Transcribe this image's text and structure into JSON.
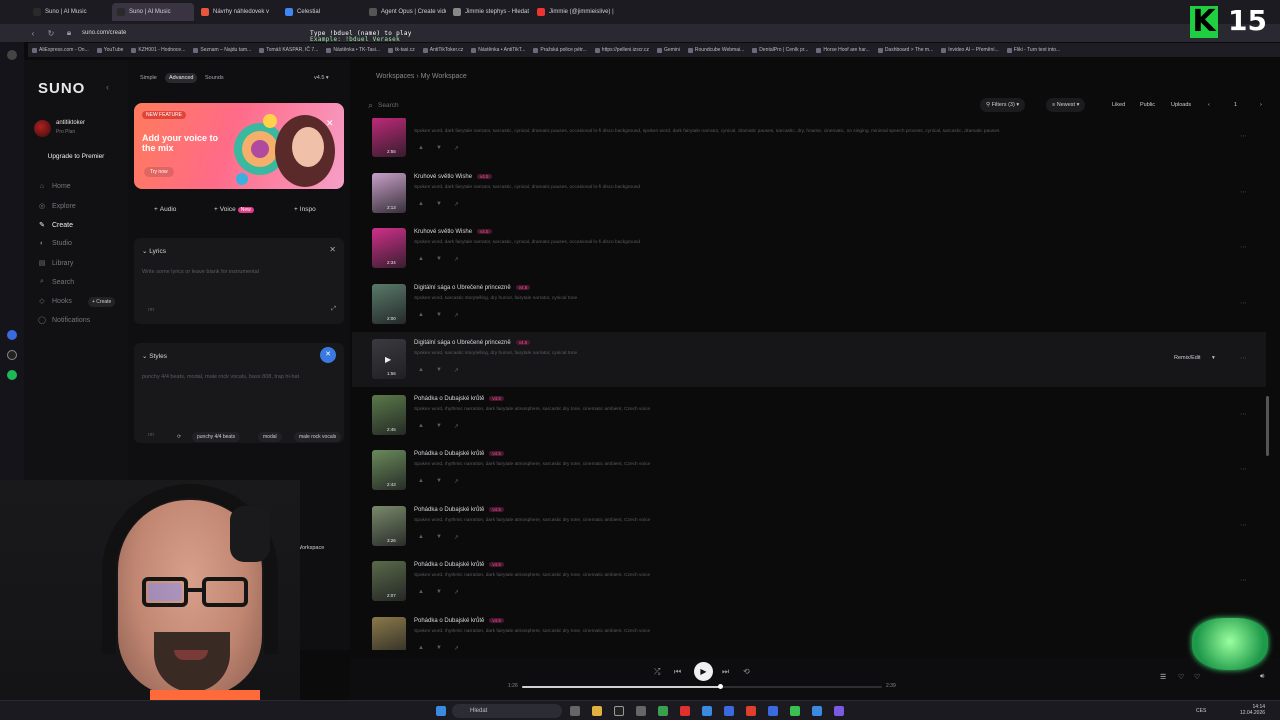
{
  "browser": {
    "tabs": [
      {
        "title": "Suno | AI Music",
        "color": "#2a2a2a"
      },
      {
        "title": "Suno | AI Music",
        "color": "#2a2a2a",
        "active": true
      },
      {
        "title": "Návrhy náhledovek v",
        "color": "#e8553d"
      },
      {
        "title": "Celestial",
        "color": "#4285f4"
      },
      {
        "title": "Agent Opus | Create video",
        "color": "#555"
      },
      {
        "title": "Jimmie stephys - Hledat G",
        "color": "#888"
      },
      {
        "title": "Jimmie (@jimmieislive) | T",
        "color": "#e33"
      }
    ],
    "url": "suno.com/create",
    "bookmarks": [
      "AliExpress.com - On...",
      "YouTube",
      "KZH001 - Hodnoce...",
      "Seznam – Najdu tam...",
      "Tomáš KASPAR, IČ 7...",
      "Nástěnka • TK-Tasi...",
      "tk-tasi.cz",
      "AntiTikToker.cz",
      "Nástěnka • AntiTikT...",
      "Pražská police pétr...",
      "https://pelleni.izscr.cz",
      "Gemini",
      "Roundcube Webmai...",
      "DentalPro | Ceník pr...",
      "Horse Hoof are har...",
      "Dashboard > The m...",
      "Invideo AI – Přemění...",
      "Fliki - Turn text into..."
    ]
  },
  "overlay": {
    "line1": "Type !bduel (name) to play",
    "line2": "Example: !bduel Verasek",
    "badge_letter": "K",
    "badge_number": "15"
  },
  "sidebar": {
    "logo": "SUNO",
    "username": "antitiktoker",
    "plan": "Pro Plan",
    "upgrade": "Upgrade to Premier",
    "nav": [
      {
        "label": "Home",
        "icon": "⌂"
      },
      {
        "label": "Explore",
        "icon": "◎"
      },
      {
        "label": "Create",
        "icon": "✎",
        "active": true
      },
      {
        "label": "Studio",
        "icon": "◐"
      },
      {
        "label": "Library",
        "icon": "▤"
      },
      {
        "label": "Search",
        "icon": "⌕"
      },
      {
        "label": "Hooks",
        "icon": "◇"
      },
      {
        "label": "Notifications",
        "icon": "◯"
      }
    ],
    "create_pill": "+ Create"
  },
  "panel": {
    "modes": [
      "Simple",
      "Advanced",
      "Sounds"
    ],
    "version": "v4.5 ▾",
    "promo": {
      "badge": "NEW FEATURE",
      "title": "Add your voice to the mix",
      "cta": "Try now"
    },
    "add_buttons": [
      {
        "label": "Audio"
      },
      {
        "label": "Voice",
        "tag": "New"
      },
      {
        "label": "Inspo"
      }
    ],
    "lyrics": {
      "title": "Lyrics",
      "placeholder": "Write some lyrics or leave blank for instrumental",
      "lang": "ım"
    },
    "styles": {
      "title": "Styles",
      "placeholder": "punchy 4/4 beats, modal, male rock vocals, bass 808, trap hi-hat",
      "lang": "ım",
      "chips": [
        "punchy 4/4 beats",
        "modal",
        "male rock vocals"
      ]
    },
    "workspace_label": "My Workspace"
  },
  "main": {
    "breadcrumb_root": "Workspaces",
    "breadcrumb_current": "My Workspace",
    "search_placeholder": "Search",
    "filters": "Filters (3)",
    "sort": "Newest",
    "liked": "Liked",
    "public": "Public",
    "uploads": "Uploads",
    "page": "1",
    "remix_label": "Remix/Edit"
  },
  "songs": [
    {
      "title": "",
      "version": "",
      "desc": "Spoken word, dark fairytale narrator, sarcastic, cynical, dramatic pauses, occasional lo-fi disco background, spoken word, dark fairytale narrator, cynical, dramatic pauses, sarcastic, dry, hoarse, cinematic, no singing, minimal speech process, cynical, sarcastic, dramatic pauses",
      "duration": "2:55",
      "cover": "#c02a7a"
    },
    {
      "title": "Kruhové světlo Wishe",
      "version": "v4.5",
      "desc": "Spoken word, dark fairytale narrator, sarcastic, cynical, dramatic pauses, occasional lo-fi disco background",
      "duration": "2:13",
      "cover": "#c8a0c8"
    },
    {
      "title": "Kruhové světlo Wishe",
      "version": "v4.5",
      "desc": "Spoken word, dark fairytale narrator, sarcastic, cynical, dramatic pauses, occasional lo-fi disco background",
      "duration": "2:34",
      "cover": "#d0308a"
    },
    {
      "title": "Digitální sága o Ubrečené princezně",
      "version": "v4.5",
      "desc": "Spoken word, sarcastic storytelling, dry humor, fairytale narrator, cynical tone",
      "duration": "2:00",
      "cover": "#5a7a6a"
    },
    {
      "title": "Digitální sága o Ubrečené princezně",
      "version": "v4.5",
      "desc": "Spoken word, sarcastic storytelling, dry humor, fairytale narrator, cynical tone",
      "duration": "1:56",
      "cover": "#3a3a40",
      "hover": true
    },
    {
      "title": "Pohádka o Dubajské krůtě",
      "version": "v4.5",
      "desc": "Spoken word, rhythmic narration, dark fairytale atmosphere, sarcastic dry tone, cinematic ambient, Czech voice",
      "duration": "2:45",
      "cover": "#5a7a4a"
    },
    {
      "title": "Pohádka o Dubajské krůtě",
      "version": "v4.5",
      "desc": "Spoken word, rhythmic narration, dark fairytale atmosphere, sarcastic dry tone, cinematic ambient, Czech voice",
      "duration": "2:43",
      "cover": "#6a8a5a"
    },
    {
      "title": "Pohádka o Dubajské krůtě",
      "version": "v4.5",
      "desc": "Spoken word, rhythmic narration, dark fairytale atmosphere, sarcastic dry tone, cinematic ambient, Czech voice",
      "duration": "3:26",
      "cover": "#7a8a6a"
    },
    {
      "title": "Pohádka o Dubajské krůtě",
      "version": "v4.5",
      "desc": "Spoken word, rhythmic narration, dark fairytale atmosphere, sarcastic dry tone, cinematic ambient, Czech voice",
      "duration": "2:07",
      "cover": "#5a6a4a"
    },
    {
      "title": "Pohádka o Dubajské krůtě",
      "version": "v4.5",
      "desc": "Spoken word, rhythmic narration, dark fairytale atmosphere, sarcastic dry tone, cinematic ambient, Czech voice",
      "duration": "2:44",
      "cover": "#8a7a4a"
    }
  ],
  "player": {
    "time_current": "1:26",
    "time_total": "2:39",
    "progress": 0.55
  },
  "taskbar": {
    "search": "Hledat",
    "lang": "CES",
    "time": "14:14",
    "date": "12.04.2026"
  }
}
